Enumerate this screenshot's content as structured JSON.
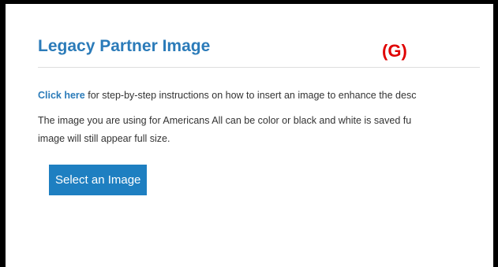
{
  "section": {
    "title": "Legacy Partner Image",
    "marker": "(G)"
  },
  "instructions": {
    "link_text": "Click here",
    "text": " for step-by-step instructions on how to insert an image to enhance the desc"
  },
  "info": {
    "line1": "The image you are using for Americans All can be color or black and white is saved fu",
    "line2": "image will still appear full size."
  },
  "actions": {
    "select_label": "Select an Image"
  },
  "colors": {
    "title_blue": "#2b7bb9",
    "button_blue": "#1e7fc1",
    "marker_red": "#e00000",
    "frame": "#000000"
  }
}
